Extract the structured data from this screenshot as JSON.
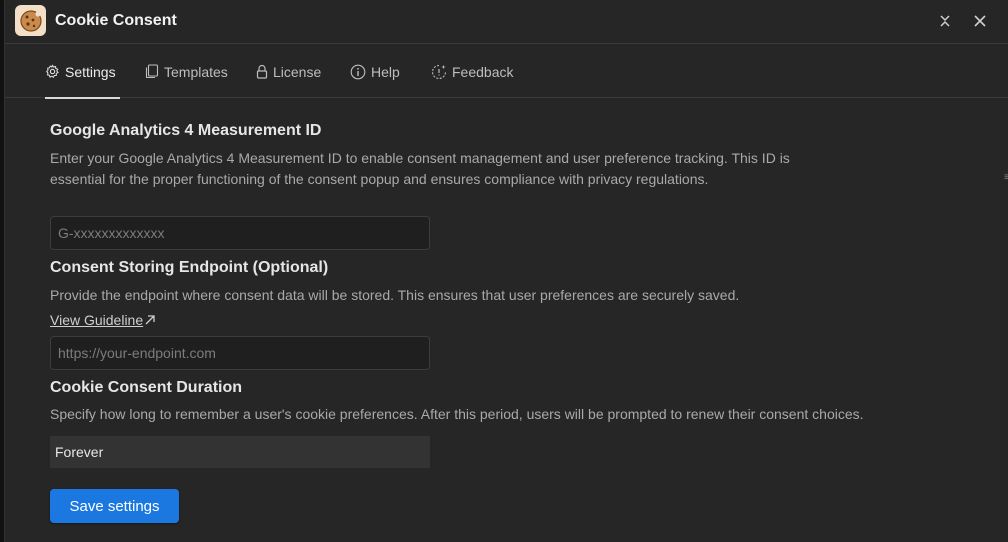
{
  "window": {
    "title": "Cookie Consent"
  },
  "tabs": [
    {
      "label": "Settings",
      "icon": "gear-icon",
      "active": true
    },
    {
      "label": "Templates",
      "icon": "templates-icon",
      "active": false
    },
    {
      "label": "License",
      "icon": "lock-icon",
      "active": false
    },
    {
      "label": "Help",
      "icon": "info-icon",
      "active": false
    },
    {
      "label": "Feedback",
      "icon": "feedback-icon",
      "active": false
    }
  ],
  "ga4": {
    "title": "Google Analytics 4 Measurement ID",
    "description": "Enter your Google Analytics 4 Measurement ID to enable consent management and user preference tracking. This ID is essential for the proper functioning of the consent popup and ensures compliance with privacy regulations.",
    "value": "",
    "placeholder": "G-xxxxxxxxxxxxx"
  },
  "endpoint": {
    "title": "Consent Storing Endpoint (Optional)",
    "description": "Provide the endpoint where consent data will be stored. This ensures that user preferences are securely saved.",
    "guideline_link": "View Guideline",
    "value": "",
    "placeholder": "https://your-endpoint.com"
  },
  "duration": {
    "title": "Cookie Consent Duration",
    "description": "Specify how long to remember a user's cookie preferences. After this period, users will be prompted to renew their consent choices.",
    "selected": "Forever"
  },
  "actions": {
    "save_label": "Save settings"
  },
  "colors": {
    "background": "#262626",
    "accent": "#1a78e0",
    "app_icon_bg": "#f3dfc5"
  }
}
